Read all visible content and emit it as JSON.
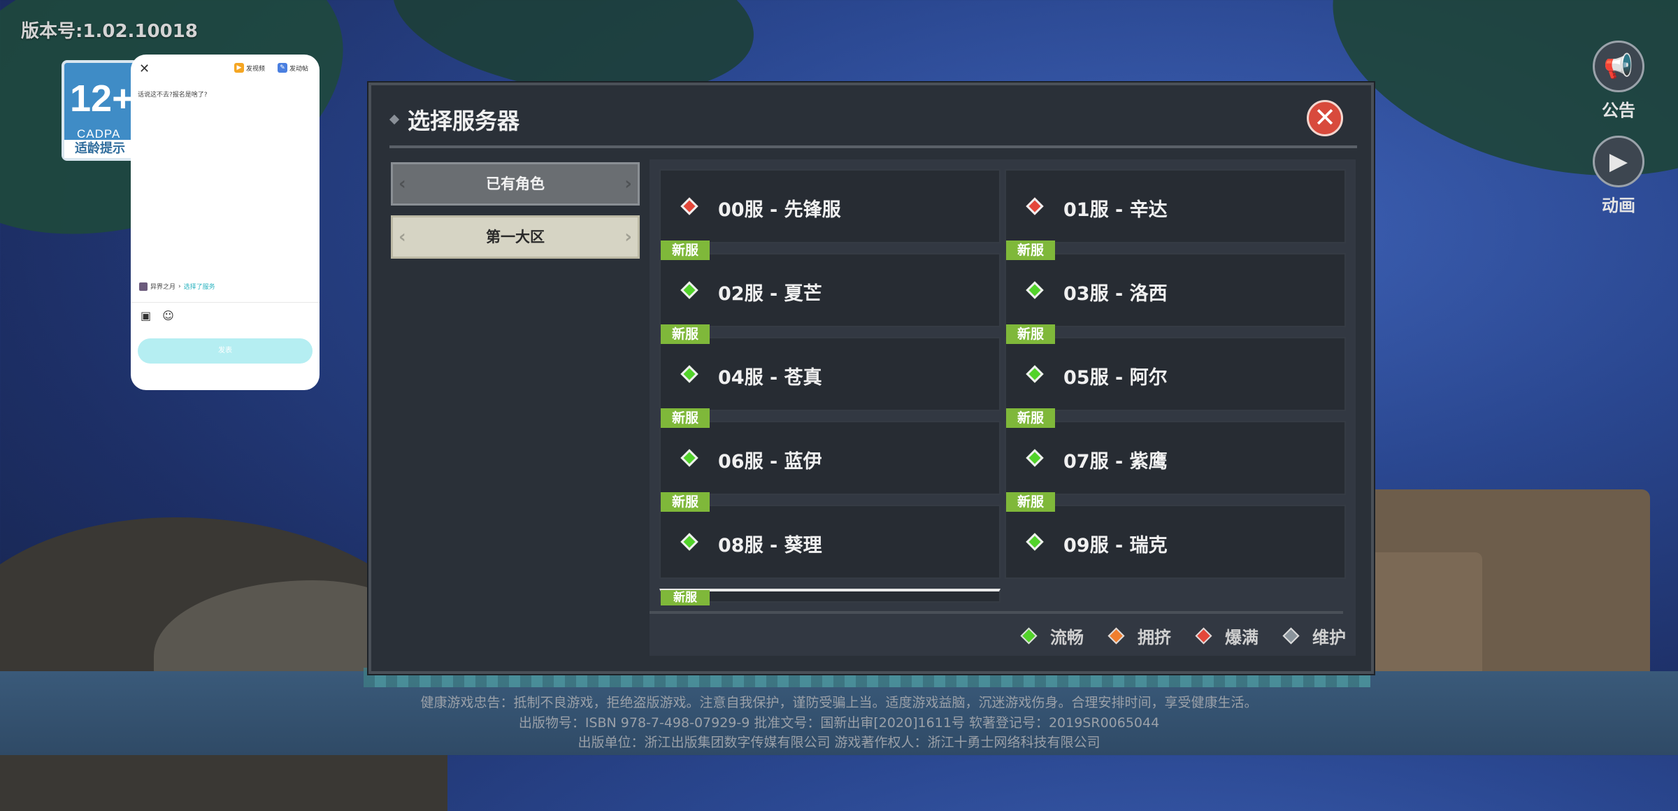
{
  "version_text": "版本号:1.02.10018",
  "age_badge": {
    "rating": "12+",
    "org": "CADPA",
    "tip": "适龄提示"
  },
  "side_buttons": {
    "notice_label": "公告",
    "anim_label": "动画"
  },
  "popup": {
    "action1": "发视频",
    "action2": "发动帖",
    "question": "话说这不去?报名是啥了?",
    "user": "异界之月",
    "link": "选择了服务",
    "send": "发表"
  },
  "dialog": {
    "title": "选择服务器",
    "close_icon": "close-x-icon",
    "categories": [
      {
        "label": "已有角色",
        "selected": false
      },
      {
        "label": "第一大区",
        "selected": true
      }
    ],
    "new_tag": "新服",
    "servers": [
      {
        "name": "00服 - 先锋服",
        "status": "red",
        "new": false
      },
      {
        "name": "01服 - 辛达",
        "status": "red",
        "new": false
      },
      {
        "name": "02服 - 夏芒",
        "status": "green",
        "new": true
      },
      {
        "name": "03服 - 洛西",
        "status": "green",
        "new": true
      },
      {
        "name": "04服 - 苍真",
        "status": "green",
        "new": true
      },
      {
        "name": "05服 - 阿尔",
        "status": "green",
        "new": true
      },
      {
        "name": "06服 - 蓝伊",
        "status": "green",
        "new": true
      },
      {
        "name": "07服 - 紫鹰",
        "status": "green",
        "new": true
      },
      {
        "name": "08服 - 葵理",
        "status": "green",
        "new": true
      },
      {
        "name": "09服 - 瑞克",
        "status": "green",
        "new": true
      }
    ],
    "legend": [
      {
        "label": "流畅",
        "color": "#52d22a"
      },
      {
        "label": "拥挤",
        "color": "#f07e2e"
      },
      {
        "label": "爆满",
        "color": "#e4473a"
      },
      {
        "label": "维护",
        "color": "#8a949c"
      }
    ]
  },
  "footer": {
    "line1": "健康游戏忠告：抵制不良游戏，拒绝盗版游戏。注意自我保护，谨防受骗上当。适度游戏益脑，沉迷游戏伤身。合理安排时间，享受健康生活。",
    "line2": "出版物号：ISBN 978-7-498-07929-9        批准文号：国新出审[2020]1611号        软著登记号：2019SR0065044",
    "line3": "出版单位：浙江出版集团数字传媒有限公司        游戏著作权人：浙江十勇士网络科技有限公司"
  }
}
